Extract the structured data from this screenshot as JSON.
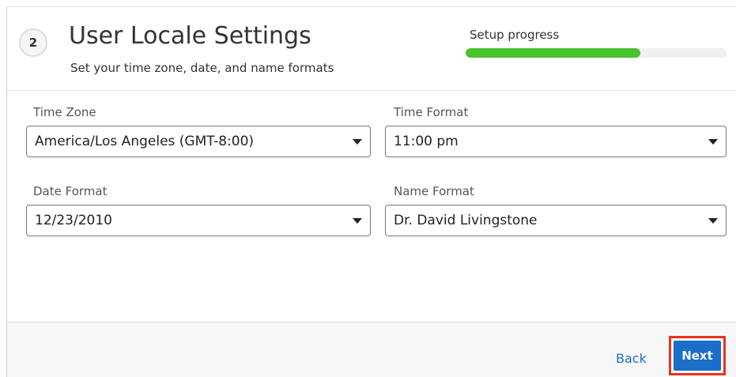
{
  "header": {
    "step_number": "2",
    "title": "User Locale Settings",
    "subtitle": "Set your time zone, date, and name formats",
    "progress_label": "Setup progress",
    "progress_fraction": 0.67,
    "progress_color": "#48c22d"
  },
  "fields": {
    "time_zone": {
      "label": "Time Zone",
      "value": "America/Los Angeles (GMT-8:00)"
    },
    "time_format": {
      "label": "Time Format",
      "value": "11:00 pm"
    },
    "date_format": {
      "label": "Date Format",
      "value": "12/23/2010"
    },
    "name_format": {
      "label": "Name Format",
      "value": "Dr. David Livingstone"
    }
  },
  "footer": {
    "back_label": "Back",
    "next_label": "Next"
  },
  "colors": {
    "accent": "#1a6fc9",
    "highlight": "#e8341c"
  }
}
